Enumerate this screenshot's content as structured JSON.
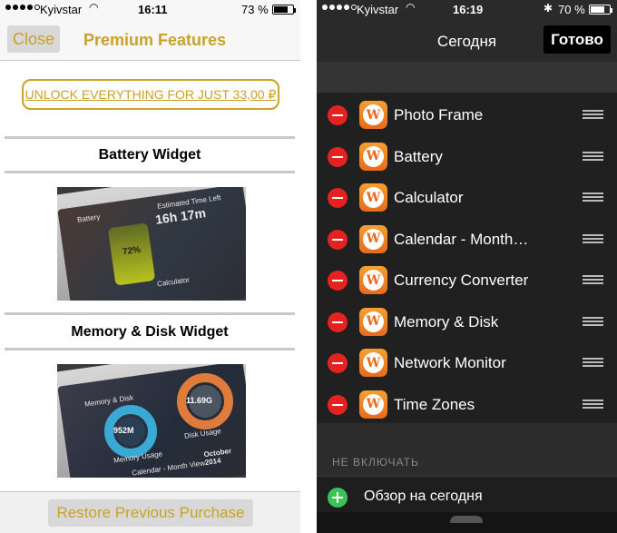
{
  "left": {
    "status": {
      "carrier": "Kyivstar",
      "time": "16:11",
      "battery": "73 %"
    },
    "nav": {
      "close_label": "Close",
      "title": "Premium Features"
    },
    "unlock_label": "UNLOCK EVERYTHING FOR JUST 33,00 ₽",
    "widgets": [
      {
        "title": "Battery Widget",
        "screenshot": {
          "row1": "Battery",
          "header": "Estimated Time Left",
          "big": "16h 17m",
          "pct": "72%",
          "row2": "Calculator"
        }
      },
      {
        "title": "Memory & Disk Widget",
        "screenshot": {
          "row1": "Memory & Disk",
          "used": "952M",
          "disk": "11.69G",
          "mem_label": "Memory Usage",
          "disk_label": "Disk Usage",
          "row2": "Calendar - Month View",
          "month": "October 2014"
        }
      }
    ],
    "restore_label": "Restore Previous Purchase"
  },
  "right": {
    "status": {
      "carrier": "Kyivstar",
      "time": "16:19",
      "battery": "70 %"
    },
    "nav": {
      "title": "Сегодня",
      "done_label": "Готово"
    },
    "widgets": [
      {
        "label": "Photo Frame"
      },
      {
        "label": "Battery"
      },
      {
        "label": "Calculator"
      },
      {
        "label": "Calendar - Month…"
      },
      {
        "label": "Currency Converter"
      },
      {
        "label": "Memory & Disk"
      },
      {
        "label": "Network Monitor"
      },
      {
        "label": "Time Zones"
      }
    ],
    "section_title": "НЕ ВКЛЮЧАТЬ",
    "overview_label": "Обзор на сегодня"
  },
  "colors": {
    "accent_gold": "#c9a227",
    "delete_red": "#e52222",
    "add_green": "#3cc25a",
    "app_orange": "#e86a1c"
  },
  "icons": {
    "wifi": "wifi-icon",
    "bluetooth": "bluetooth-icon",
    "battery": "battery-icon",
    "app": "widgets-app-icon",
    "reorder": "reorder-handle-icon",
    "delete": "minus-circle-icon",
    "add": "plus-circle-icon"
  }
}
